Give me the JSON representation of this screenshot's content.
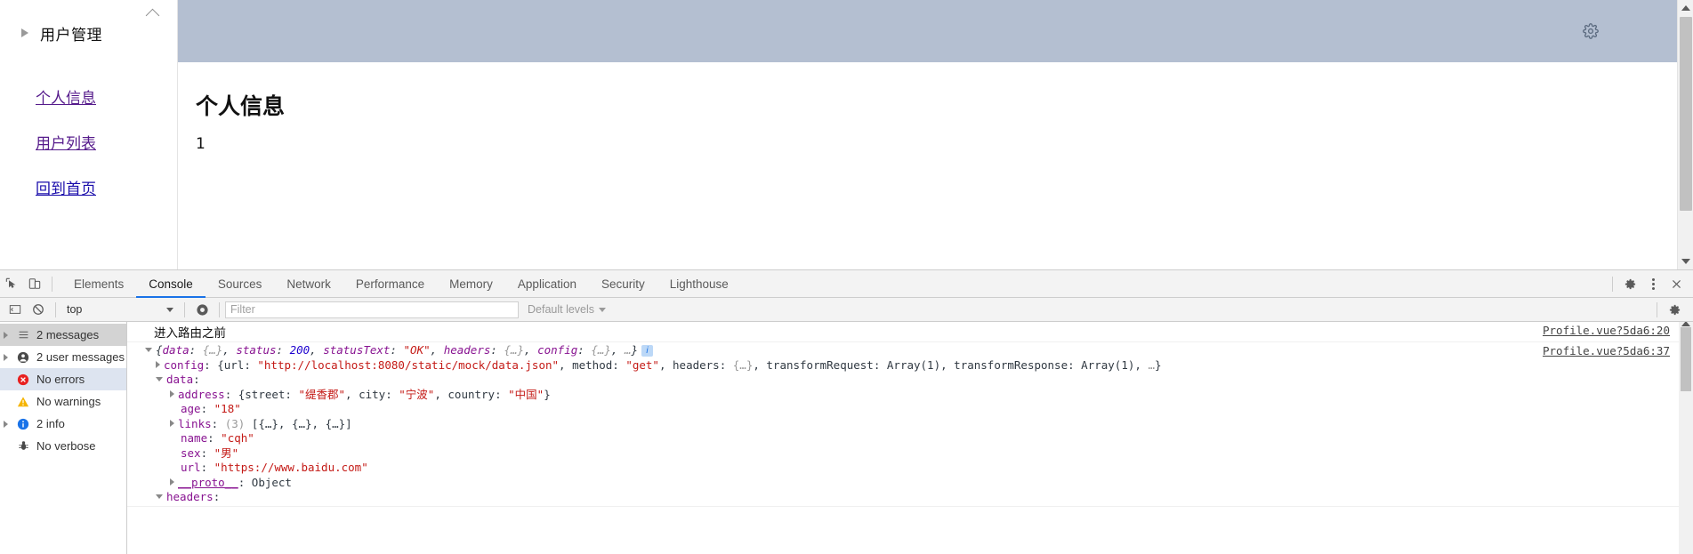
{
  "page": {
    "sidebar": {
      "collapse_title": "用户管理",
      "expand_icon": "triangle-right-icon",
      "collapse_icon": "chevron-up-icon",
      "links": [
        {
          "label": "个人信息",
          "state": "visited"
        },
        {
          "label": "用户列表",
          "state": "visited"
        },
        {
          "label": "回到首页",
          "state": "unvisited"
        }
      ]
    },
    "content": {
      "header_color": "#b4bfd1",
      "gear_icon": "gear-icon",
      "title": "个人信息",
      "value": "1"
    },
    "scrollbar": {
      "up_icon": "scroll-up-arrow",
      "down_icon": "scroll-down-arrow"
    }
  },
  "devtools": {
    "toolbar": {
      "inspect_icon": "inspect-element-icon",
      "device_icon": "device-toolbar-icon",
      "settings_icon": "gear-icon",
      "more_icon": "kebab-menu-icon",
      "close_icon": "close-icon"
    },
    "tabs": [
      {
        "label": "Elements",
        "active": false
      },
      {
        "label": "Console",
        "active": true
      },
      {
        "label": "Sources",
        "active": false
      },
      {
        "label": "Network",
        "active": false
      },
      {
        "label": "Performance",
        "active": false
      },
      {
        "label": "Memory",
        "active": false
      },
      {
        "label": "Application",
        "active": false
      },
      {
        "label": "Security",
        "active": false
      },
      {
        "label": "Lighthouse",
        "active": false
      }
    ],
    "filterbar": {
      "sidebar_toggle_icon": "console-sidebar-toggle-icon",
      "clear_icon": "clear-console-icon",
      "context": "top",
      "eye_icon": "live-expression-icon",
      "filter_placeholder": "Filter",
      "filter_value": "",
      "levels": "Default levels",
      "settings_icon": "gear-icon"
    },
    "sidebar": [
      {
        "label": "2 messages",
        "icon": "list-icon",
        "expandable": true,
        "selected": "strong"
      },
      {
        "label": "2 user messages",
        "icon": "user-icon",
        "expandable": true,
        "selected": "none"
      },
      {
        "label": "No errors",
        "icon": "error-icon",
        "expandable": false,
        "selected": "light"
      },
      {
        "label": "No warnings",
        "icon": "warning-icon",
        "expandable": false,
        "selected": "none"
      },
      {
        "label": "2 info",
        "icon": "info-icon",
        "expandable": true,
        "selected": "none"
      },
      {
        "label": "No verbose",
        "icon": "verbose-bug-icon",
        "expandable": false,
        "selected": "none"
      }
    ],
    "console": {
      "row1": {
        "text": "进入路由之前",
        "source": "Profile.vue?5da6:20"
      },
      "row2": {
        "source": "Profile.vue?5da6:37",
        "summary": {
          "k_data": "data",
          "v_data": "{…}",
          "k_status": "status",
          "v_status": "200",
          "k_statusText": "statusText",
          "v_statusText": "\"OK\"",
          "k_headers": "headers",
          "v_headers": "{…}",
          "k_config": "config",
          "v_config": "{…}",
          "ellipsis": "…",
          "badge": "i"
        },
        "config": {
          "key": "config",
          "k_url": "url",
          "v_url": "\"http://localhost:8080/static/mock/data.json\"",
          "k_method": "method",
          "v_method": "\"get\"",
          "k_headers": "headers",
          "v_headers": "{…}",
          "k_tr": "transformRequest",
          "v_tr": "Array(1)",
          "k_tres": "transformResponse",
          "v_tres": "Array(1)",
          "ellipsis": "…"
        },
        "data": {
          "key": "data",
          "address": {
            "key": "address",
            "k_street": "street",
            "v_street": "\"缇香郡\"",
            "k_city": "city",
            "v_city": "\"宁波\"",
            "k_country": "country",
            "v_country": "\"中国\""
          },
          "age": {
            "key": "age",
            "value": "\"18\""
          },
          "links": {
            "key": "links",
            "count": "(3)",
            "value": "[{…}, {…}, {…}]"
          },
          "name": {
            "key": "name",
            "value": "\"cqh\""
          },
          "sex": {
            "key": "sex",
            "value": "\"男\""
          },
          "url": {
            "key": "url",
            "value": "\"https://www.baidu.com\""
          },
          "proto": {
            "key": "__proto__",
            "value": "Object"
          }
        },
        "headers": {
          "key": "headers"
        }
      }
    }
  }
}
